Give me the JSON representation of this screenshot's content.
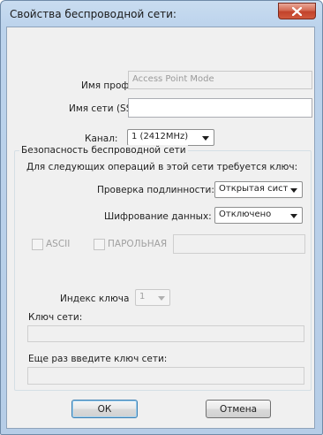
{
  "window": {
    "title": "Свойства беспроводной сети:"
  },
  "profile": {
    "label": "Имя профиля:",
    "value": "Access Point Mode"
  },
  "ssid": {
    "label": "Имя сети (SSID):",
    "value": ""
  },
  "channel": {
    "label": "Канал:",
    "value": "1  (2412MHz)"
  },
  "security": {
    "group_title": "Безопасность беспроводной сети",
    "hint": "Для следующих операций в этой сети требуется ключ:",
    "auth_label": "Проверка подлинности:",
    "auth_value": "Открытая сист",
    "encryption_label": "Шифрование данных:",
    "encryption_value": "Отключено",
    "ascii_label": "ASCII",
    "passphrase_label": "ПАРОЛЬНАЯ",
    "passphrase_value": "",
    "key_index_label": "Индекс ключа",
    "key_index_value": "1",
    "network_key_label": "Ключ сети:",
    "network_key_value": "",
    "confirm_key_label": "Еще раз введите ключ сети:",
    "confirm_key_value": ""
  },
  "buttons": {
    "ok": "ОК",
    "cancel": "Отмена"
  },
  "colors": {
    "window_frame": "#b6cde7",
    "client_bg": "#f0f0f0",
    "close_button": "#c2432b",
    "default_button_border": "#3c7fb1"
  }
}
